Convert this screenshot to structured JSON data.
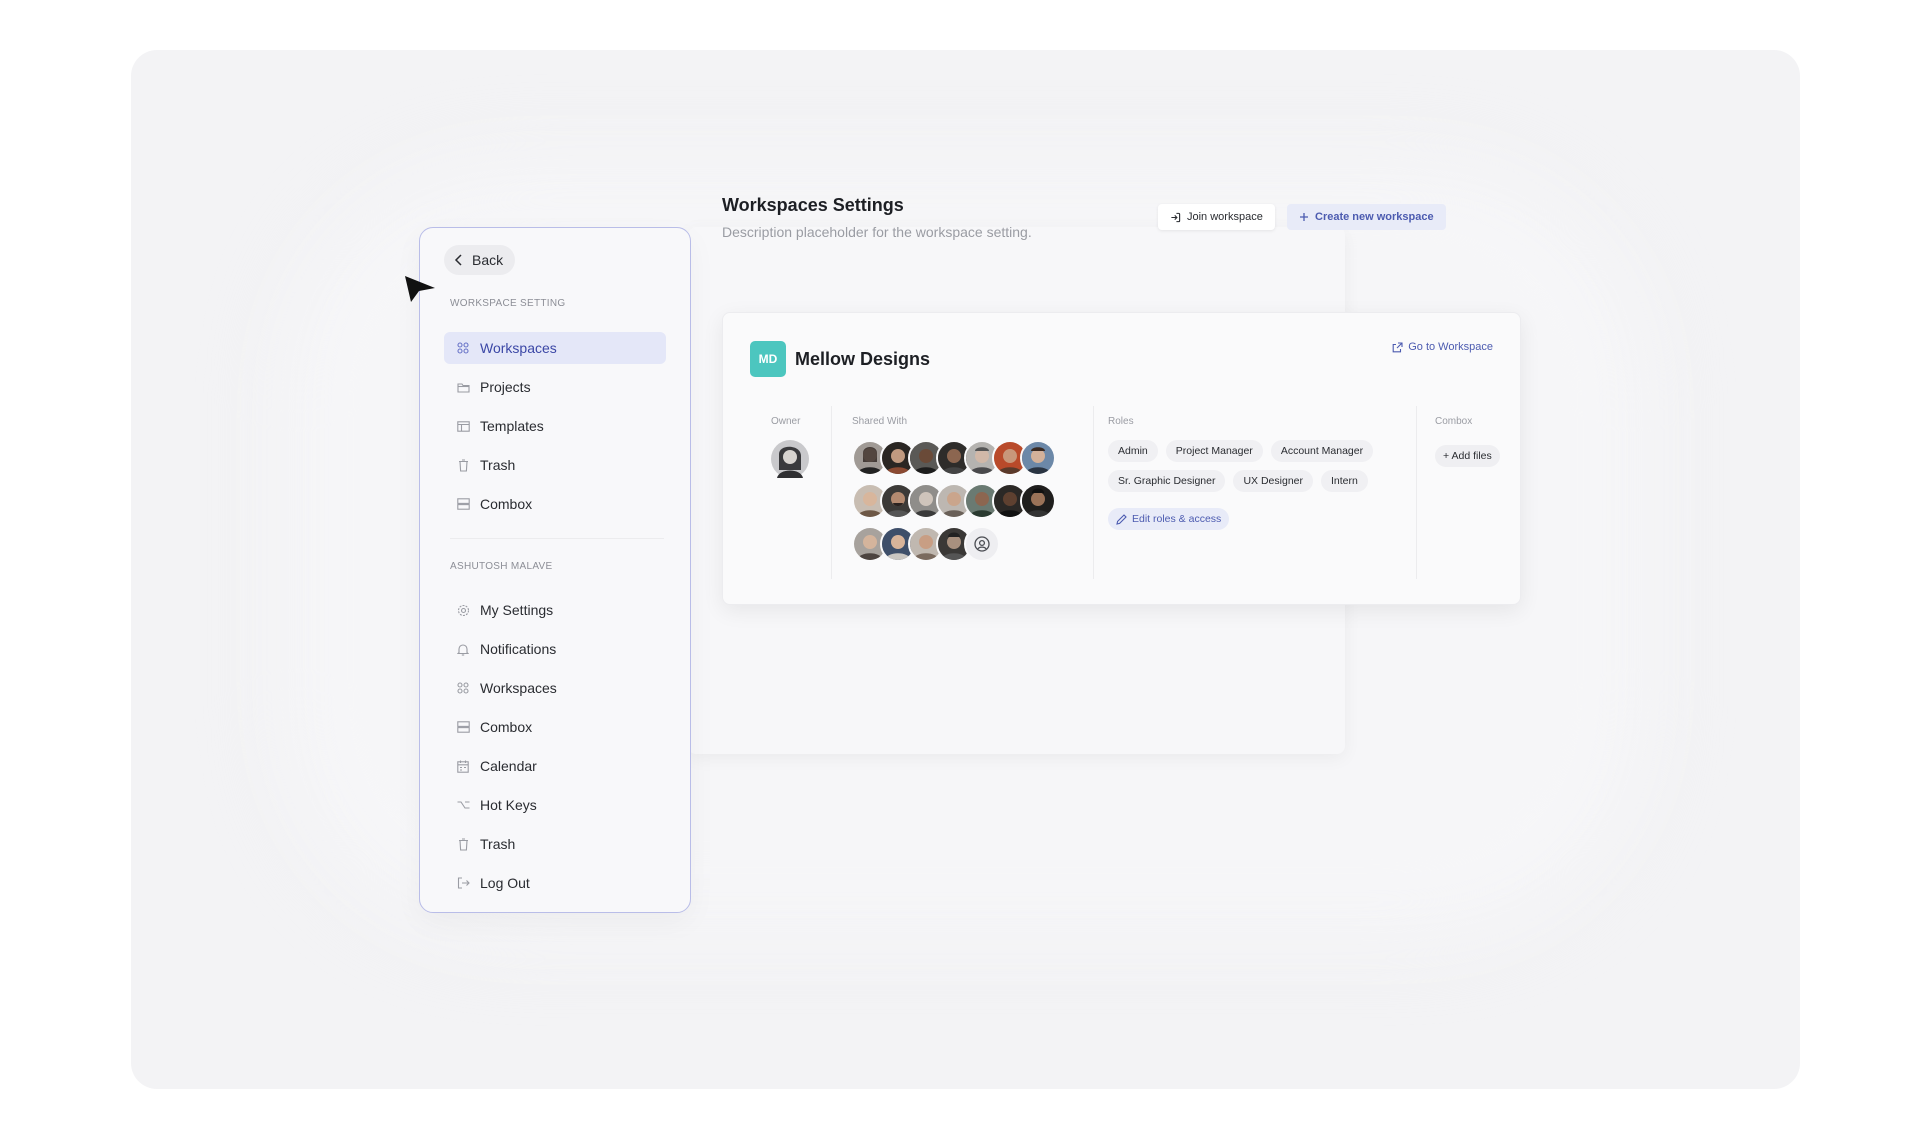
{
  "header": {
    "title": "Workspaces Settings",
    "description": "Description placeholder for the workspace setting.",
    "join_label": "Join workspace",
    "create_label": "Create new workspace"
  },
  "sidebar": {
    "back_label": "Back",
    "section1_label": "WORKSPACE SETTING",
    "section1_items": [
      {
        "label": "Workspaces",
        "icon": "grid-icon",
        "active": true
      },
      {
        "label": "Projects",
        "icon": "folder-icon",
        "active": false
      },
      {
        "label": "Templates",
        "icon": "layout-icon",
        "active": false
      },
      {
        "label": "Trash",
        "icon": "trash-icon",
        "active": false
      },
      {
        "label": "Combox",
        "icon": "stack-icon",
        "active": false
      }
    ],
    "section2_label": "ASHUTOSH MALAVE",
    "section2_items": [
      {
        "label": "My Settings",
        "icon": "gear-icon"
      },
      {
        "label": "Notifications",
        "icon": "bell-icon"
      },
      {
        "label": "Workspaces",
        "icon": "grid-icon"
      },
      {
        "label": "Combox",
        "icon": "stack-icon"
      },
      {
        "label": "Calendar",
        "icon": "calendar-icon"
      },
      {
        "label": "Hot Keys",
        "icon": "option-key-icon"
      },
      {
        "label": "Trash",
        "icon": "trash-icon"
      },
      {
        "label": "Log Out",
        "icon": "logout-icon"
      }
    ]
  },
  "workspace_card": {
    "logo_initials": "MD",
    "logo_color": "#4cc6bf",
    "name": "Mellow Designs",
    "go_label": "Go to Workspace",
    "owner_label": "Owner",
    "shared_label": "Shared With",
    "roles_label": "Roles",
    "combox_label": "Combox",
    "shared_rows": [
      7,
      7,
      4
    ],
    "roles": [
      "Admin",
      "Project Manager",
      "Account  Manager",
      "Sr. Graphic Designer",
      "UX Designer",
      "Intern"
    ],
    "edit_roles_label": "Edit roles & access",
    "add_files_label": "+ Add files"
  },
  "colors": {
    "accent": "#4c5bb0",
    "active_bg": "#e4e7f8",
    "sidebar_border": "#b9bde8"
  }
}
